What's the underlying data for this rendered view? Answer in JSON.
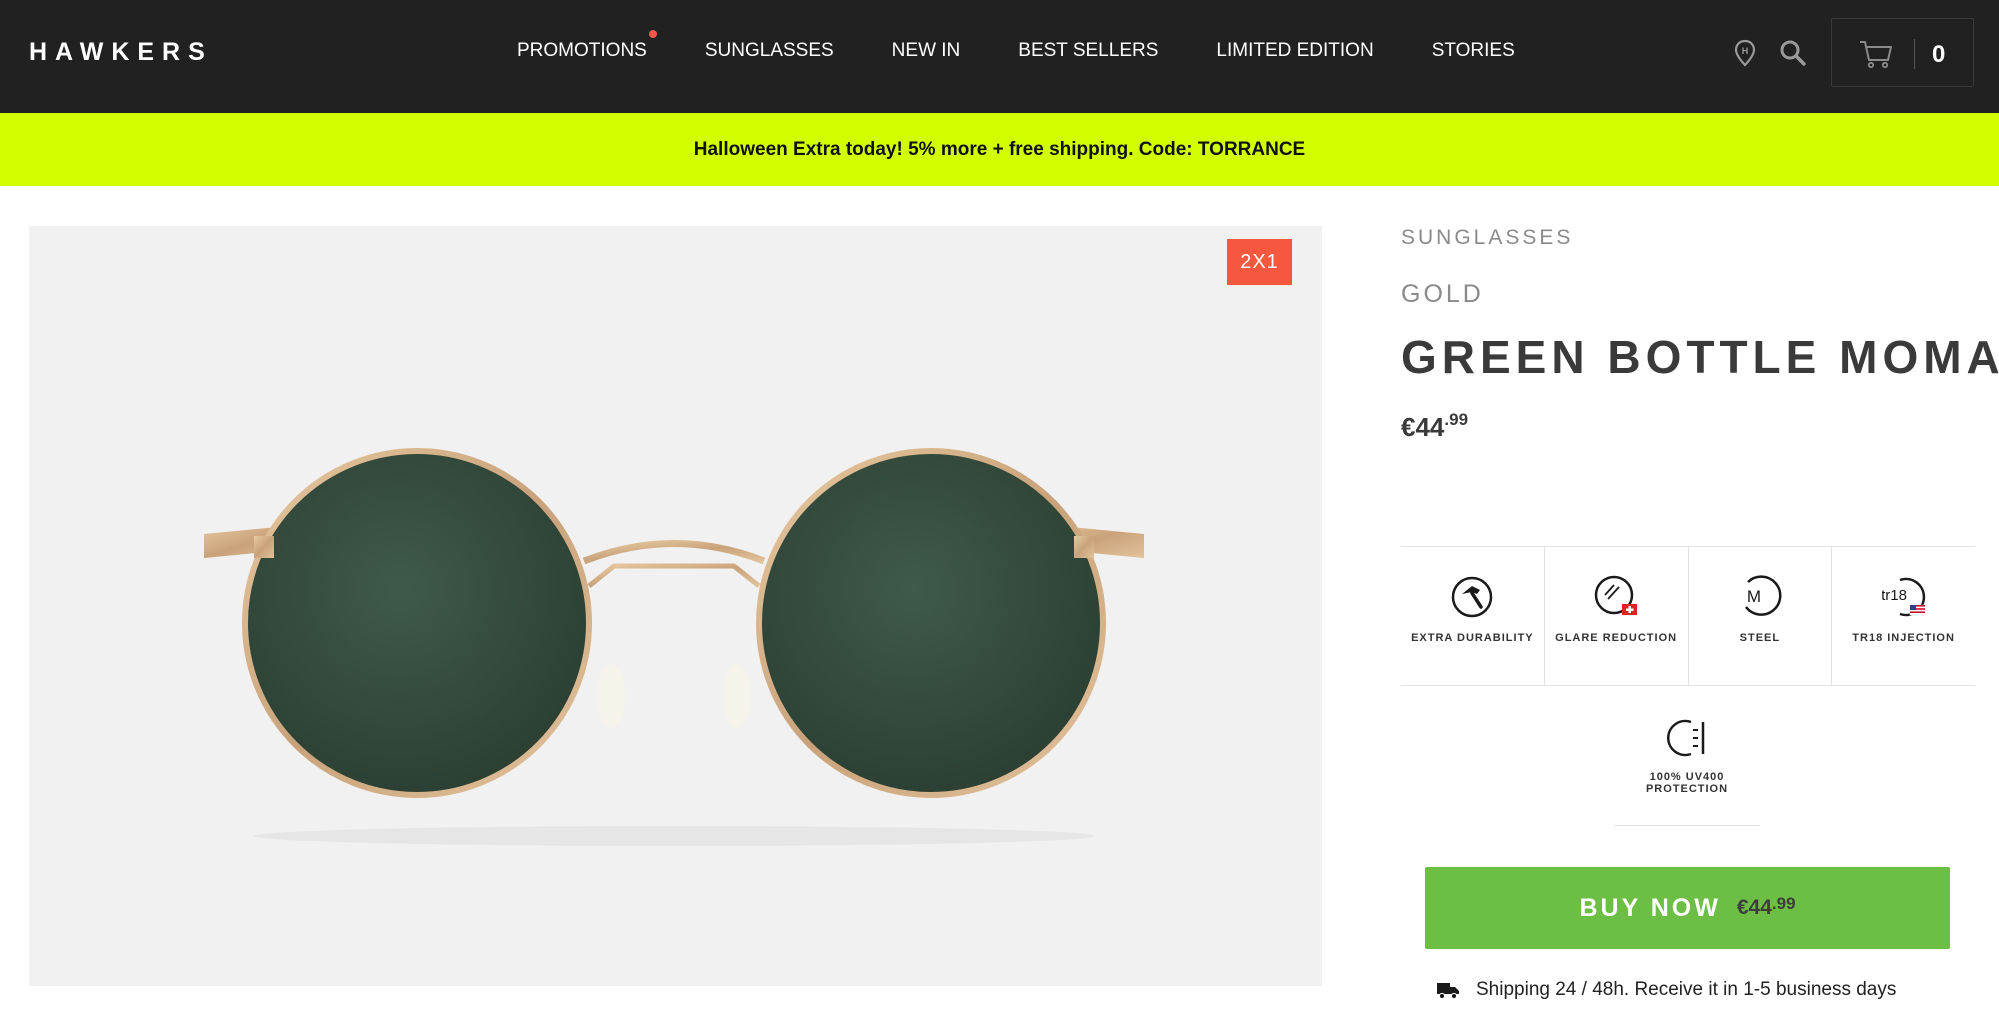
{
  "header": {
    "logo": "HAWKERS",
    "nav": [
      {
        "label": "PROMOTIONS",
        "dot": true
      },
      {
        "label": "SUNGLASSES"
      },
      {
        "label": "NEW IN"
      },
      {
        "label": "BEST SELLERS"
      },
      {
        "label": "LIMITED EDITION"
      },
      {
        "label": "STORIES"
      }
    ],
    "icons": [
      "location-pin-icon",
      "search-icon",
      "cart-icon"
    ],
    "cart_count": "0"
  },
  "promo": {
    "text": "Halloween Extra today! 5% more + free shipping. Code: TORRANCE",
    "color": "#d2ff00"
  },
  "product": {
    "badge": "2X1",
    "category": "SUNGLASSES",
    "color": "GOLD",
    "name": "GREEN BOTTLE MOMA",
    "price_main": "€44",
    "price_cents": ".99",
    "features": [
      {
        "label": "EXTRA DURABILITY",
        "icon": "hammer-icon"
      },
      {
        "label": "GLARE REDUCTION",
        "icon": "glare-reduction-icon"
      },
      {
        "label": "STEEL",
        "icon": "steel-icon"
      },
      {
        "label": "TR18 INJECTION",
        "icon": "tr18-icon"
      },
      {
        "label": "100% UV400 PROTECTION",
        "icon": "uv-protection-icon"
      }
    ],
    "buy": {
      "label": "BUY NOW",
      "price_main": "€44",
      "price_cents": ".99",
      "color": "#6cbe44"
    },
    "shipping": "Shipping 24 / 48h. Receive it in 1-5 business days"
  },
  "colors": {
    "header_bg": "#212121",
    "badge": "#f5573f",
    "accent_dot": "#f2594b"
  }
}
